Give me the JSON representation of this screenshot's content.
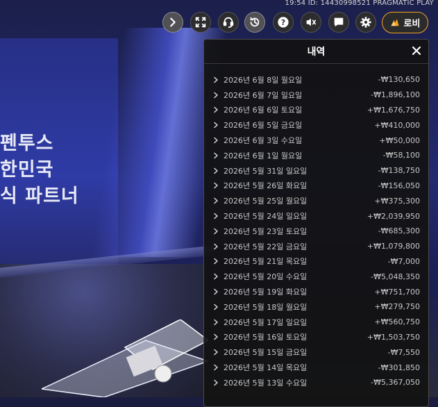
{
  "top_info": "19:54 ID: 14430998521 PRAGMATIC PLAY",
  "promo_lines": [
    "펜투스",
    "한민국",
    "식 파트너"
  ],
  "toolbar": {
    "buttons": [
      {
        "icon": "chevron-right-icon"
      },
      {
        "icon": "fullscreen-icon"
      },
      {
        "icon": "headset-icon"
      },
      {
        "icon": "history-icon"
      },
      {
        "icon": "help-icon"
      },
      {
        "icon": "mute-icon"
      },
      {
        "icon": "chat-icon"
      },
      {
        "icon": "settings-icon"
      }
    ],
    "lobby_label": "로비"
  },
  "history": {
    "title": "내역",
    "rows": [
      {
        "date": "2026년 6월 8일 월요일",
        "amount": "-₩130,650"
      },
      {
        "date": "2026년 6월 7일 일요일",
        "amount": "-₩1,896,100"
      },
      {
        "date": "2026년 6월 6일 토요일",
        "amount": "+₩1,676,750"
      },
      {
        "date": "2026년 6월 5일 금요일",
        "amount": "+₩410,000"
      },
      {
        "date": "2026년 6월 3일 수요일",
        "amount": "+₩50,000"
      },
      {
        "date": "2026년 6월 1일 월요일",
        "amount": "-₩58,100"
      },
      {
        "date": "2026년 5월 31일 일요일",
        "amount": "-₩138,750"
      },
      {
        "date": "2026년 5월 26일 화요일",
        "amount": "-₩156,050"
      },
      {
        "date": "2026년 5월 25일 월요일",
        "amount": "+₩375,300"
      },
      {
        "date": "2026년 5월 24일 일요일",
        "amount": "+₩2,039,950"
      },
      {
        "date": "2026년 5월 23일 토요일",
        "amount": "-₩685,300"
      },
      {
        "date": "2026년 5월 22일 금요일",
        "amount": "+₩1,079,800"
      },
      {
        "date": "2026년 5월 21일 목요일",
        "amount": "-₩7,000"
      },
      {
        "date": "2026년 5월 20일 수요일",
        "amount": "-₩5,048,350"
      },
      {
        "date": "2026년 5월 19일 화요일",
        "amount": "+₩751,700"
      },
      {
        "date": "2026년 5월 18일 월요일",
        "amount": "+₩279,750"
      },
      {
        "date": "2026년 5월 17일 일요일",
        "amount": "+₩560,750"
      },
      {
        "date": "2026년 5월 16일 토요일",
        "amount": "+₩1,503,750"
      },
      {
        "date": "2026년 5월 15일 금요일",
        "amount": "-₩7,550"
      },
      {
        "date": "2026년 5월 14일 목요일",
        "amount": "-₩301,850"
      },
      {
        "date": "2026년 5월 13일 수요일",
        "amount": "-₩5,367,050"
      }
    ]
  },
  "colors": {
    "accent": "#f5a623",
    "panel_bg": "#121212",
    "text": "#c9c9c9"
  }
}
